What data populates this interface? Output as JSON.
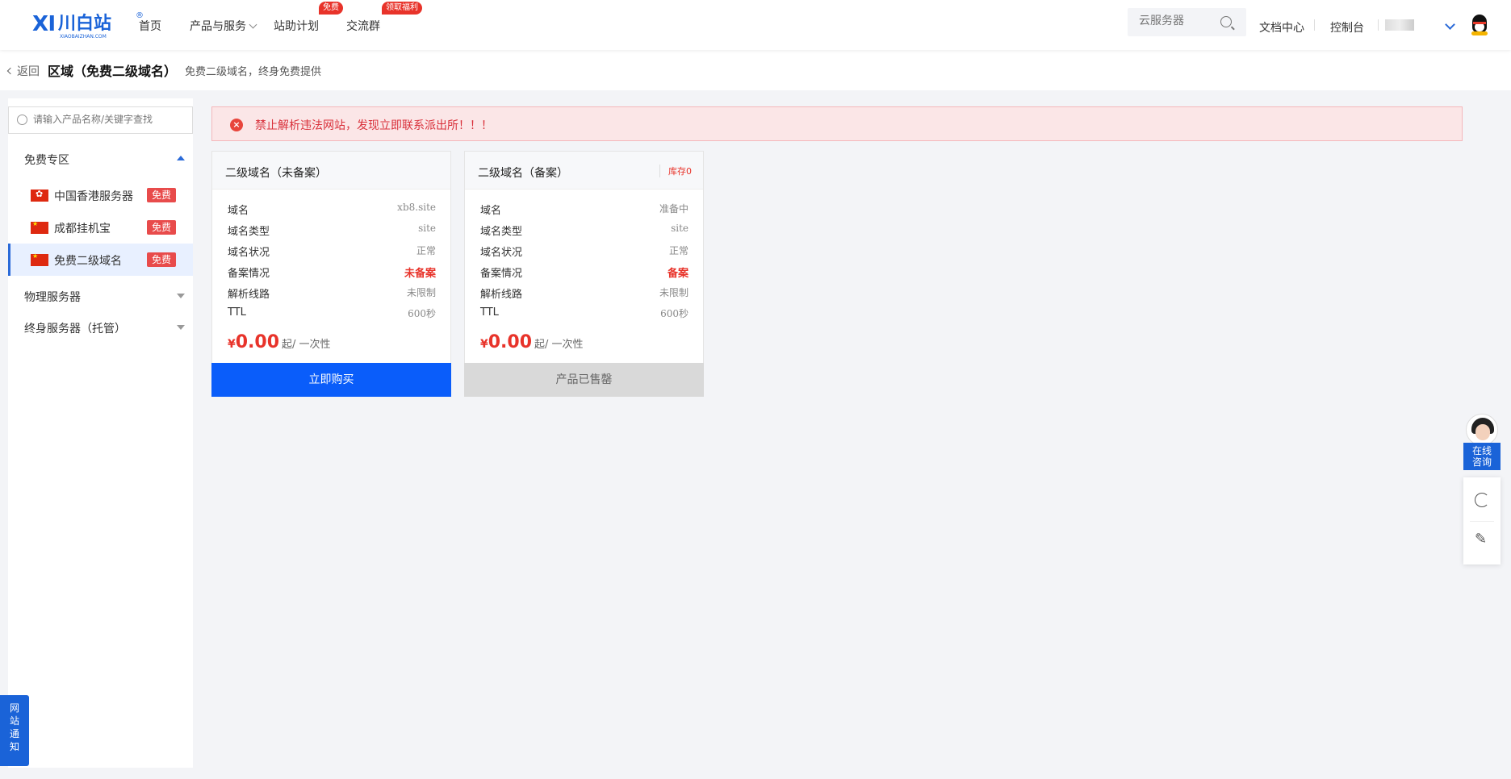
{
  "logo": {
    "mark": "Ⅺ",
    "name": "川白站",
    "sub": "XIAOBAIZHAN.COM",
    "reg": "®"
  },
  "nav": {
    "home": "首页",
    "products": "产品与服务",
    "plan": "站助计划",
    "plan_badge": "免费",
    "group": "交流群",
    "group_badge": "领取福利"
  },
  "header": {
    "search_placeholder": "云服务器",
    "docs": "文档中心",
    "console": "控制台"
  },
  "breadcrumb": {
    "back": "返回",
    "title": "区域（免费二级域名）",
    "subtitle": "免费二级域名，终身免费提供"
  },
  "sidebar": {
    "search_placeholder": "请输入产品名称/关键字查找",
    "group_free": "免费专区",
    "items": [
      {
        "label": "中国香港服务器",
        "tag": "免费"
      },
      {
        "label": "成都挂机宝",
        "tag": "免费"
      },
      {
        "label": "免费二级域名",
        "tag": "免费"
      }
    ],
    "group_physical": "物理服务器",
    "group_lifetime": "终身服务器（托管）"
  },
  "alert": {
    "text": "禁止解析违法网站，发现立即联系派出所！！！"
  },
  "cards": [
    {
      "title": "二级域名（未备案）",
      "stock": "",
      "specs": [
        {
          "k": "域名",
          "v": "xb8.site"
        },
        {
          "k": "域名类型",
          "v": "site"
        },
        {
          "k": "域名状况",
          "v": "正常"
        },
        {
          "k": "备案情况",
          "v": "未备案"
        },
        {
          "k": "解析线路",
          "v": "未限制"
        },
        {
          "k": "TTL",
          "v": "600秒"
        }
      ],
      "price_currency": "¥",
      "price": "0.00",
      "price_unit": "起/ 一次性",
      "button": "立即购买"
    },
    {
      "title": "二级域名（备案）",
      "stock": "库存0",
      "specs": [
        {
          "k": "域名",
          "v": "准备中"
        },
        {
          "k": "域名类型",
          "v": "site"
        },
        {
          "k": "域名状况",
          "v": "正常"
        },
        {
          "k": "备案情况",
          "v": "备案"
        },
        {
          "k": "解析线路",
          "v": "未限制"
        },
        {
          "k": "TTL",
          "v": "600秒"
        }
      ],
      "price_currency": "¥",
      "price": "0.00",
      "price_unit": "起/ 一次性",
      "button": "产品已售罄"
    }
  ],
  "float": {
    "consult": "在线咨询",
    "notice": "网站通知"
  },
  "colors": {
    "brand": "#1a63d8",
    "buy": "#0a5dfa",
    "alert_text": "#d9303a",
    "danger": "#e8332a"
  }
}
